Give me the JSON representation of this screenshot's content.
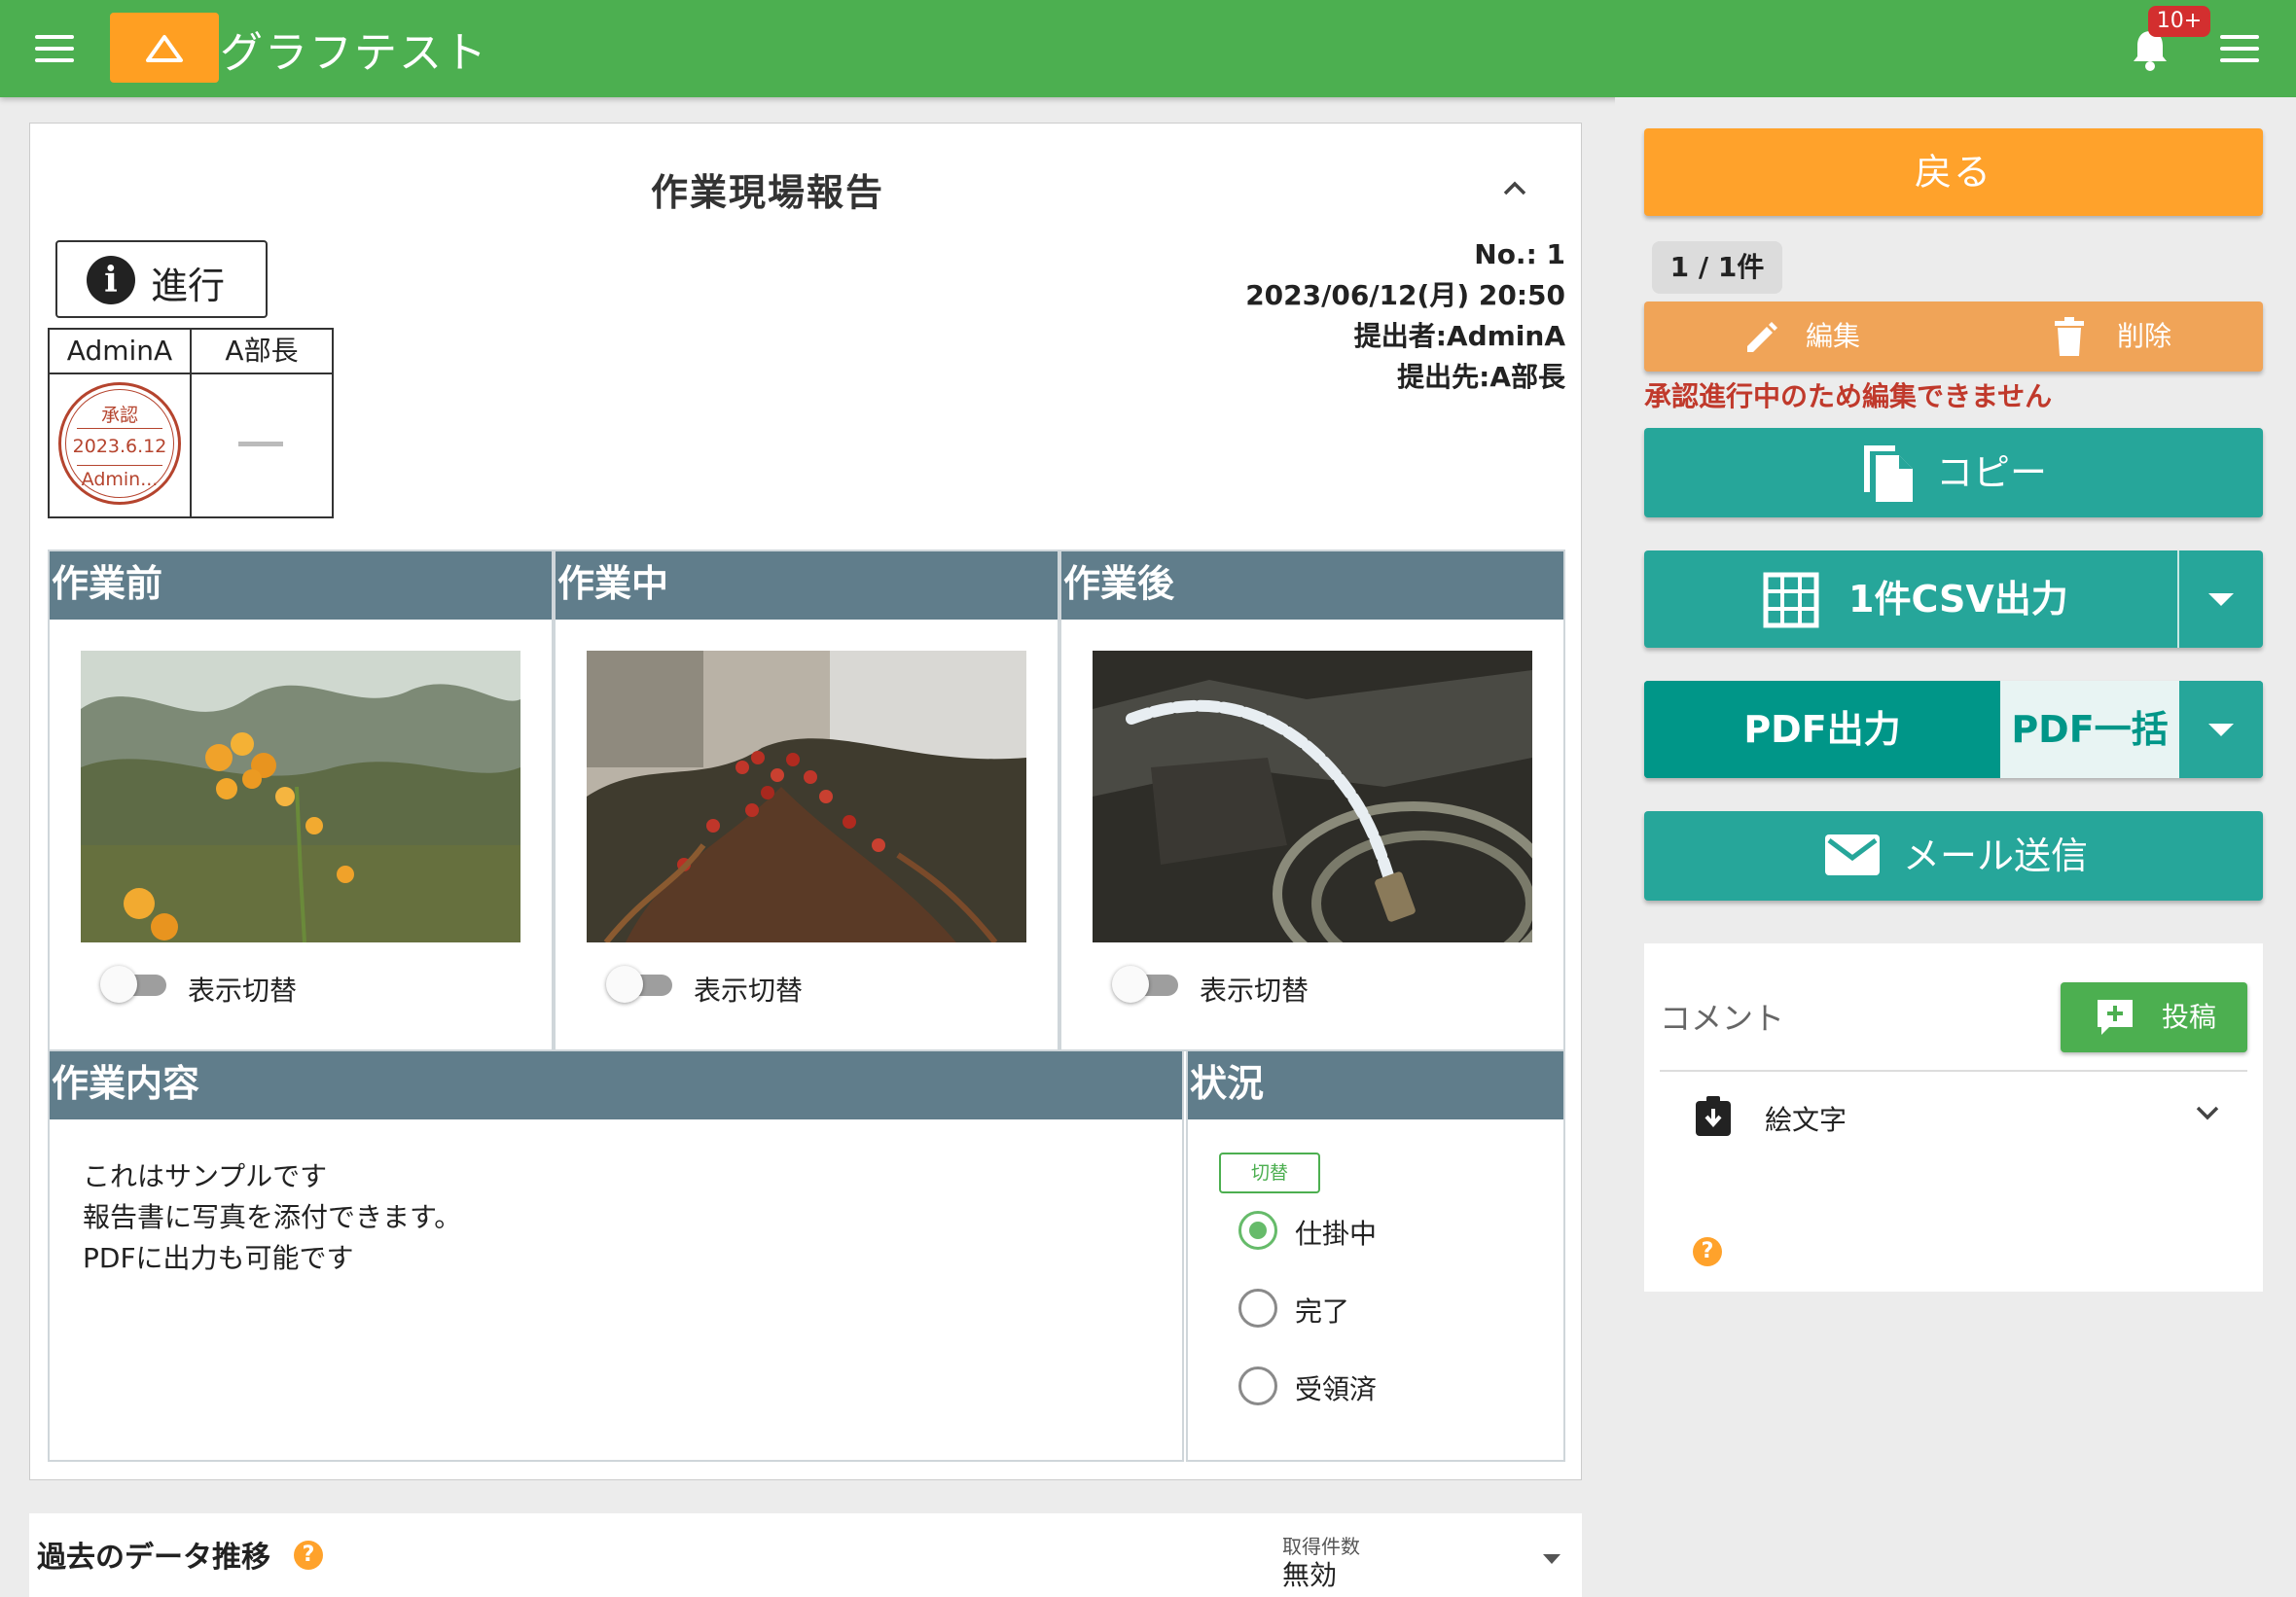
{
  "header": {
    "app_title": "グラフテスト",
    "notification_badge": "10+",
    "brand_color": "#4caf50",
    "logo_color": "#ff9f22"
  },
  "report": {
    "title": "作業現場報告",
    "status_label": "進行",
    "meta": {
      "no": "No.: 1",
      "datetime": "2023/06/12(月) 20:50",
      "submitter": "提出者:AdminA",
      "recipient": "提出先:A部長"
    },
    "approvals": [
      {
        "name": "AdminA",
        "stamp": {
          "title": "承認",
          "date": "2023.6.12",
          "user": "Admin..."
        }
      },
      {
        "name": "A部長",
        "stamp": null
      }
    ],
    "photos": [
      {
        "heading": "作業前",
        "toggle_label": "表示切替",
        "toggle_on": false
      },
      {
        "heading": "作業中",
        "toggle_label": "表示切替",
        "toggle_on": false
      },
      {
        "heading": "作業後",
        "toggle_label": "表示切替",
        "toggle_on": false
      }
    ],
    "contents": {
      "heading": "作業内容",
      "lines": [
        "これはサンプルです",
        "報告書に写真を添付できます。",
        "PDFに出力も可能です"
      ]
    },
    "situation": {
      "heading": "状況",
      "switch_label": "切替",
      "options": [
        {
          "label": "仕掛中",
          "selected": true
        },
        {
          "label": "完了",
          "selected": false
        },
        {
          "label": "受領済",
          "selected": false
        }
      ]
    }
  },
  "history": {
    "title": "過去のデータ推移",
    "fetch_label": "取得件数",
    "fetch_value": "無効"
  },
  "sidebar": {
    "back": "戻る",
    "count": "1 / 1件",
    "edit": "編集",
    "delete": "削除",
    "warning": "承認進行中のため編集できません",
    "copy": "コピー",
    "csv": "1件CSV出力",
    "pdf": "PDF出力",
    "pdf_bulk": "PDF一括",
    "mail": "メール送信",
    "comment": {
      "title": "コメント",
      "post": "投稿",
      "emoji": "絵文字"
    }
  }
}
